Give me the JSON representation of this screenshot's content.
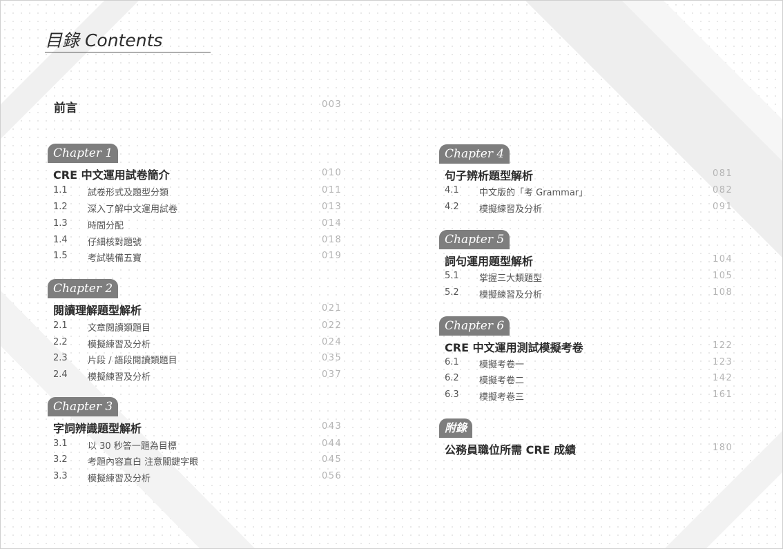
{
  "title": "目錄 Contents",
  "preface": {
    "label": "前言",
    "page": "003"
  },
  "chapters": [
    {
      "tag": "Chapter 1",
      "title": "CRE 中文運用試卷簡介",
      "page": "010",
      "sections": [
        {
          "num": "1.1",
          "title": "試卷形式及題型分類",
          "page": "011"
        },
        {
          "num": "1.2",
          "title": "深入了解中文運用試卷",
          "page": "013"
        },
        {
          "num": "1.3",
          "title": "時間分配",
          "page": "014"
        },
        {
          "num": "1.4",
          "title": "仔細核對題號",
          "page": "018"
        },
        {
          "num": "1.5",
          "title": "考試裝備五寶",
          "page": "019"
        }
      ]
    },
    {
      "tag": "Chapter 2",
      "title": "閱讀理解題型解析",
      "page": "021",
      "sections": [
        {
          "num": "2.1",
          "title": "文章閱讀類題目",
          "page": "022"
        },
        {
          "num": "2.2",
          "title": "模擬練習及分析",
          "page": "024"
        },
        {
          "num": "2.3",
          "title": "片段 / 語段閱讀類題目",
          "page": "035"
        },
        {
          "num": "2.4",
          "title": "模擬練習及分析",
          "page": "037"
        }
      ]
    },
    {
      "tag": "Chapter 3",
      "title": "字詞辨識題型解析",
      "page": "043",
      "sections": [
        {
          "num": "3.1",
          "title": "以 30 秒答一題為目標",
          "page": "044"
        },
        {
          "num": "3.2",
          "title": "考題內容直白 注意關鍵字眼",
          "page": "045"
        },
        {
          "num": "3.3",
          "title": "模擬練習及分析",
          "page": "056"
        }
      ]
    },
    {
      "tag": "Chapter 4",
      "title": "句子辨析題型解析",
      "page": "081",
      "sections": [
        {
          "num": "4.1",
          "title": "中文版的「考 Grammar」",
          "page": "082"
        },
        {
          "num": "4.2",
          "title": "模擬練習及分析",
          "page": "091"
        }
      ]
    },
    {
      "tag": "Chapter 5",
      "title": "詞句運用題型解析",
      "page": "104",
      "sections": [
        {
          "num": "5.1",
          "title": "掌握三大類題型",
          "page": "105"
        },
        {
          "num": "5.2",
          "title": "模擬練習及分析",
          "page": "108"
        }
      ]
    },
    {
      "tag": "Chapter 6",
      "title": "CRE 中文運用測試模擬考卷",
      "page": "122",
      "sections": [
        {
          "num": "6.1",
          "title": "模擬考卷一",
          "page": "123"
        },
        {
          "num": "6.2",
          "title": "模擬考卷二",
          "page": "142"
        },
        {
          "num": "6.3",
          "title": "模擬考卷三",
          "page": "161"
        }
      ]
    }
  ],
  "appendix": {
    "tag": "附錄",
    "title": "公務員職位所需 CRE 成績",
    "page": "180"
  }
}
